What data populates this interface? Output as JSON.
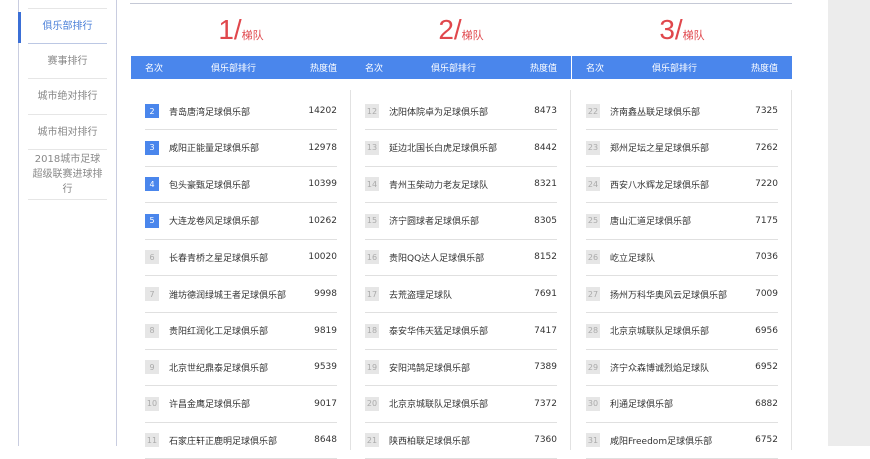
{
  "sidebar": {
    "items": [
      {
        "label": "俱乐部排行",
        "active": true
      },
      {
        "label": "赛事排行"
      },
      {
        "label": "城市绝对排行"
      },
      {
        "label": "城市相对排行"
      },
      {
        "label": "2018城市足球超级联赛进球排行"
      }
    ]
  },
  "table_headers": {
    "rank": "名次",
    "club": "俱乐部排行",
    "heat": "热度值"
  },
  "tiers": [
    {
      "num": "1/",
      "label": "梯队",
      "rows": [
        {
          "rank": "2",
          "name": "青岛唐湾足球俱乐部",
          "value": "14202"
        },
        {
          "rank": "3",
          "name": "咸阳正能量足球俱乐部",
          "value": "12978"
        },
        {
          "rank": "4",
          "name": "包头豪甄足球俱乐部",
          "value": "10399"
        },
        {
          "rank": "5",
          "name": "大连龙卷风足球俱乐部",
          "value": "10262"
        },
        {
          "rank": "6",
          "name": "长春青桥之星足球俱乐部",
          "value": "10020"
        },
        {
          "rank": "7",
          "name": "潍坊德润绿城王者足球俱乐部",
          "value": "9998"
        },
        {
          "rank": "8",
          "name": "贵阳红润化工足球俱乐部",
          "value": "9819"
        },
        {
          "rank": "9",
          "name": "北京世纪鼎泰足球俱乐部",
          "value": "9539"
        },
        {
          "rank": "10",
          "name": "许昌金鹰足球俱乐部",
          "value": "9017"
        },
        {
          "rank": "11",
          "name": "石家庄轩正鹿明足球俱乐部",
          "value": "8648"
        }
      ]
    },
    {
      "num": "2/",
      "label": "梯队",
      "rows": [
        {
          "rank": "12",
          "name": "沈阳体院卓为足球俱乐部",
          "value": "8473"
        },
        {
          "rank": "13",
          "name": "延边北国长白虎足球俱乐部",
          "value": "8442"
        },
        {
          "rank": "14",
          "name": "青州玉柴动力老友足球队",
          "value": "8321"
        },
        {
          "rank": "15",
          "name": "济宁圆球者足球俱乐部",
          "value": "8305"
        },
        {
          "rank": "16",
          "name": "贵阳QQ达人足球俱乐部",
          "value": "8152"
        },
        {
          "rank": "17",
          "name": "去荒盗理足球队",
          "value": "7691"
        },
        {
          "rank": "18",
          "name": "泰安华伟天猛足球俱乐部",
          "value": "7417"
        },
        {
          "rank": "19",
          "name": "安阳鸿鹄足球俱乐部",
          "value": "7389"
        },
        {
          "rank": "20",
          "name": "北京京城联队足球俱乐部",
          "value": "7372"
        },
        {
          "rank": "21",
          "name": "陕西柏联足球俱乐部",
          "value": "7360"
        }
      ]
    },
    {
      "num": "3/",
      "label": "梯队",
      "rows": [
        {
          "rank": "22",
          "name": "济南鑫丛联足球俱乐部",
          "value": "7325"
        },
        {
          "rank": "23",
          "name": "郑州足坛之星足球俱乐部",
          "value": "7262"
        },
        {
          "rank": "24",
          "name": "西安八水辉龙足球俱乐部",
          "value": "7220"
        },
        {
          "rank": "25",
          "name": "唐山汇道足球俱乐部",
          "value": "7175"
        },
        {
          "rank": "26",
          "name": "屹立足球队",
          "value": "7036"
        },
        {
          "rank": "27",
          "name": "扬州万科华奥风云足球俱乐部",
          "value": "7009"
        },
        {
          "rank": "28",
          "name": "北京京城联队足球俱乐部",
          "value": "6956"
        },
        {
          "rank": "29",
          "name": "济宁众森博诚烈焰足球队",
          "value": "6952"
        },
        {
          "rank": "30",
          "name": "利通足球俱乐部",
          "value": "6882"
        },
        {
          "rank": "31",
          "name": "咸阳Freedom足球俱乐部",
          "value": "6752"
        }
      ]
    }
  ]
}
